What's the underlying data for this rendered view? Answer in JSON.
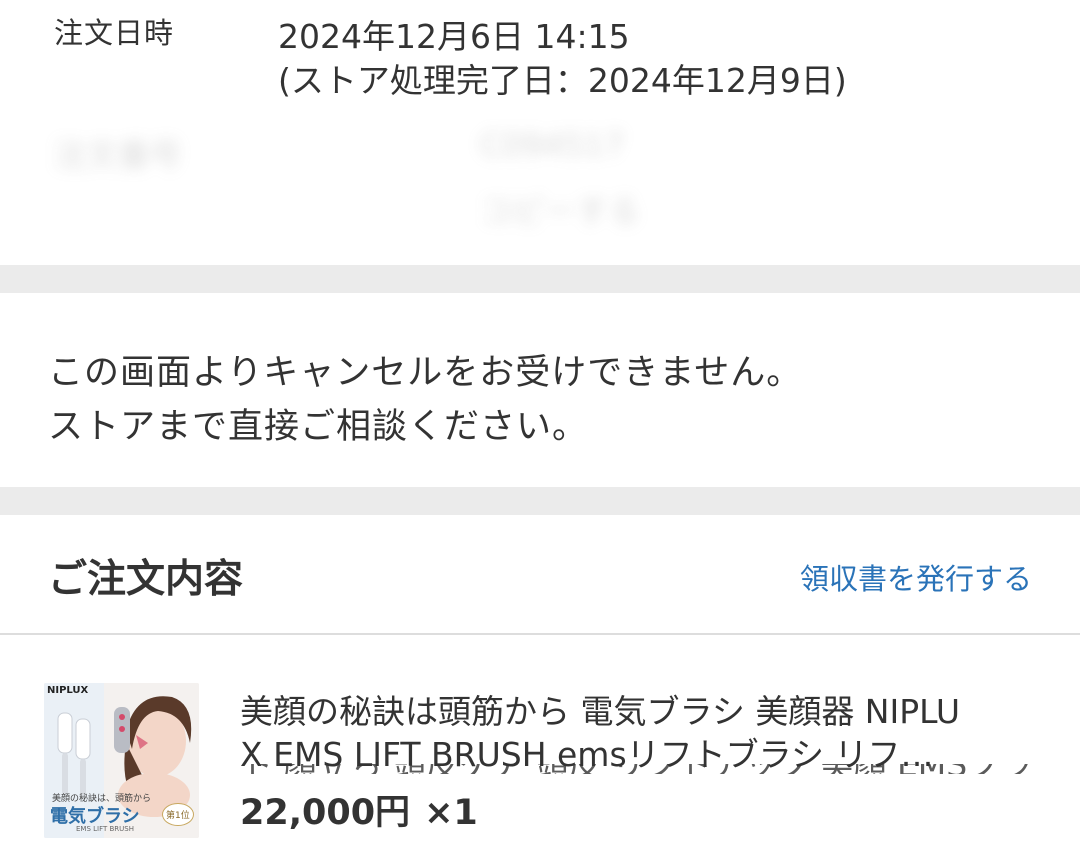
{
  "order": {
    "date_label": "注文日時",
    "date_value": "2024年12月6日 14:15",
    "store_complete": "(ストア処理完了日：2024年12月9日)",
    "blurred_label": "注文番号",
    "blurred_value": "C094517",
    "blurred_action": "コピーする"
  },
  "notice": {
    "line1": "この画面よりキャンセルをお受けできません。",
    "line2": "ストアまで直接ご相談ください。"
  },
  "contents": {
    "title": "ご注文内容",
    "receipt_link": "領収書を発行する"
  },
  "item": {
    "title_line1": "美顔の秘訣は頭筋から 電気ブラシ 美顔器 NIPLU",
    "title_line2": "X EMS LIFT BRUSH emsリフトブラシ リフ…",
    "price": "22,000円",
    "quantity": "×1",
    "thumb": {
      "brand": "NIPLUX",
      "tagline": "美顔の秘訣は、頭筋から",
      "product": "電気ブラシ",
      "badge": "第1位",
      "sub": "EMS LIFT BRUSH"
    }
  },
  "colors": {
    "link": "#2a73b8",
    "section_gap": "#ebebeb",
    "text": "#333333"
  }
}
